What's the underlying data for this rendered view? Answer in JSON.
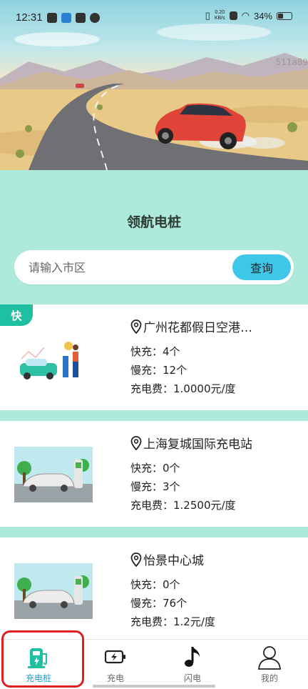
{
  "status_bar": {
    "time": "12:31",
    "net_speed": "0.20\nKB/s",
    "battery": "34%"
  },
  "hero": {
    "watermark": "511a89"
  },
  "page": {
    "title": "领航电桩"
  },
  "search": {
    "placeholder": "请输入市区",
    "value": "",
    "button_label": "查询"
  },
  "stations": [
    {
      "badge": "快",
      "name": "广州花都假日空港…",
      "fast": "快充：4个",
      "slow": "慢充：12个",
      "fee": "充电费：1.0000元/度"
    },
    {
      "badge": "",
      "name": "上海复城国际充电站",
      "fast": "快充：0个",
      "slow": "慢充：3个",
      "fee": "充电费：1.2500元/度"
    },
    {
      "badge": "",
      "name": "怡景中心城",
      "fast": "快充：0个",
      "slow": "慢充：76个",
      "fee": "充电费：1.2元/度"
    }
  ],
  "bottom_nav": {
    "active": 0,
    "items": [
      {
        "label": "充电桩",
        "icon": "charging-pile-icon"
      },
      {
        "label": "充电",
        "icon": "battery-charge-icon"
      },
      {
        "label": "闪电",
        "icon": "music-note-icon"
      },
      {
        "label": "我的",
        "icon": "user-icon"
      }
    ]
  },
  "colors": {
    "accent": "#1e9fd0",
    "mint_background": "#aeeadb",
    "search_button": "#3fc7ea",
    "fast_badge": "#1fbfa2",
    "highlight": "#e02020"
  }
}
